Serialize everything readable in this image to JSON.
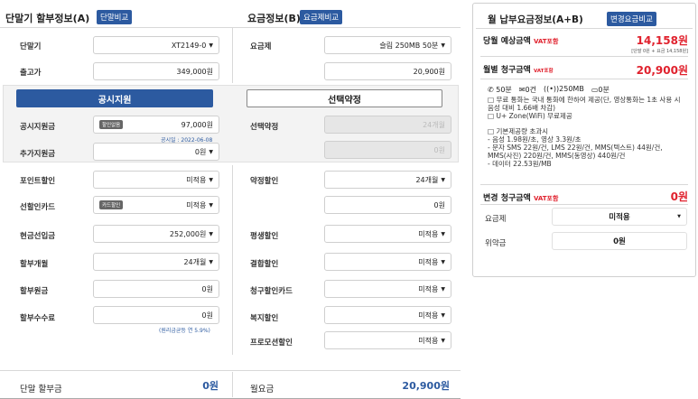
{
  "device": {
    "title": "단말기 할부정보(A)",
    "compare_btn": "단말비교",
    "model_label": "단말기",
    "model_value": "XT2149-0",
    "price_label": "출고가",
    "price_value": "349,000원"
  },
  "plan": {
    "title": "요금정보(B)",
    "compare_btn": "요금제비교",
    "plan_label": "요금제",
    "plan_value": "슬림 250MB 50분",
    "plan_fee": "20,900원"
  },
  "tabs": {
    "subsidy": "공시지원",
    "contract": "선택약정"
  },
  "subsidy": {
    "label": "공시지원금",
    "tag": "할인없음",
    "value": "97,000원",
    "date": "공시일 : 2022-06-08",
    "extra_label": "추가지원금",
    "extra_value": "0원"
  },
  "contract": {
    "label": "선택약정",
    "value": "24개월",
    "value2": "0원"
  },
  "left_rows": [
    {
      "label": "포인트할인",
      "value": "미적용"
    },
    {
      "label": "선할인카드",
      "tag": "카드할인",
      "value": "미적용"
    },
    {
      "label": "현금선입금",
      "value": "252,000원"
    },
    {
      "label": "할부개월",
      "value": "24개월"
    },
    {
      "label": "할부원금",
      "value": "0원"
    },
    {
      "label": "할부수수료",
      "value": "0원",
      "note": "(원리금균등 연 5.9%)"
    }
  ],
  "right_rows": [
    {
      "label": "약정할인",
      "value": "24개월"
    },
    {
      "label": "",
      "value": "0원"
    },
    {
      "label": "평생할인",
      "value": "미적용"
    },
    {
      "label": "결합할인",
      "value": "미적용"
    },
    {
      "label": "청구할인카드",
      "value": "미적용"
    },
    {
      "label": "복지할인",
      "value": "미적용"
    },
    {
      "label": "프로모션할인",
      "value": "미적용"
    }
  ],
  "totals": {
    "device_label": "단말 할부금",
    "device_value": "0원",
    "monthly_label": "월요금",
    "monthly_value": "20,900원"
  },
  "summary": {
    "title": "월 납부요금정보(A+B)",
    "change_btn": "변경요금비교",
    "expected_label": "당월 예상금액",
    "vat": "VAT포함",
    "expected_value": "14,158원",
    "expected_note": "[단말 0원 + 요금 14,158원]",
    "monthly_label": "월별 청구금액",
    "monthly_value": "20,900원",
    "feature_voice": "50분",
    "feature_sms": "0건",
    "feature_data": "250MB",
    "feature_video": "0분",
    "detail1": "□ 무료 통화는 국내 통화에 한하여 제공(단, 영상통화는 1초 사용 시 음성 대비 1.66배 차감)",
    "detail2": "□ U+ Zone(WiFi) 무료제공",
    "detail3": "□ 기본제공량 초과시",
    "detail4": "- 음성 1.98원/초, 영상 3.3원/초",
    "detail5": "- 문자 SMS 22원/건, LMS 22원/건, MMS(텍스트) 44원/건, MMS(사진) 220원/건, MMS(동영상) 440원/건",
    "detail6": "- 데이터 22.53원/MB",
    "change_label": "변경 청구금액",
    "change_value": "0원",
    "plan_label": "요금제",
    "plan_value": "미적용",
    "penalty_label": "위약금",
    "penalty_value": "0원"
  },
  "colors": {
    "brand": "#2c5aa0",
    "accent_red": "#e0212d"
  }
}
